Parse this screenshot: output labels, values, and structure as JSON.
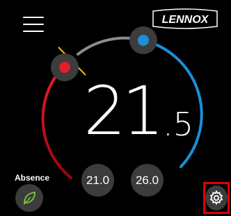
{
  "brand": {
    "name": "LENNOX"
  },
  "temperature": {
    "integer": "21",
    "decimal": "5"
  },
  "setpoints": {
    "heat": "21.0",
    "cool": "26.0"
  },
  "absence": {
    "label": "Absence"
  },
  "colors": {
    "heat_accent": "#e0202a",
    "cool_accent": "#1a8fd8",
    "arc_neutral": "#8c8c8c",
    "leaf": "#7ec840",
    "highlight": "#e00000",
    "knob": "#3c3c3c"
  },
  "icons": {
    "menu": "hamburger-icon",
    "absence": "leaf-icon",
    "settings": "gear-icon"
  }
}
